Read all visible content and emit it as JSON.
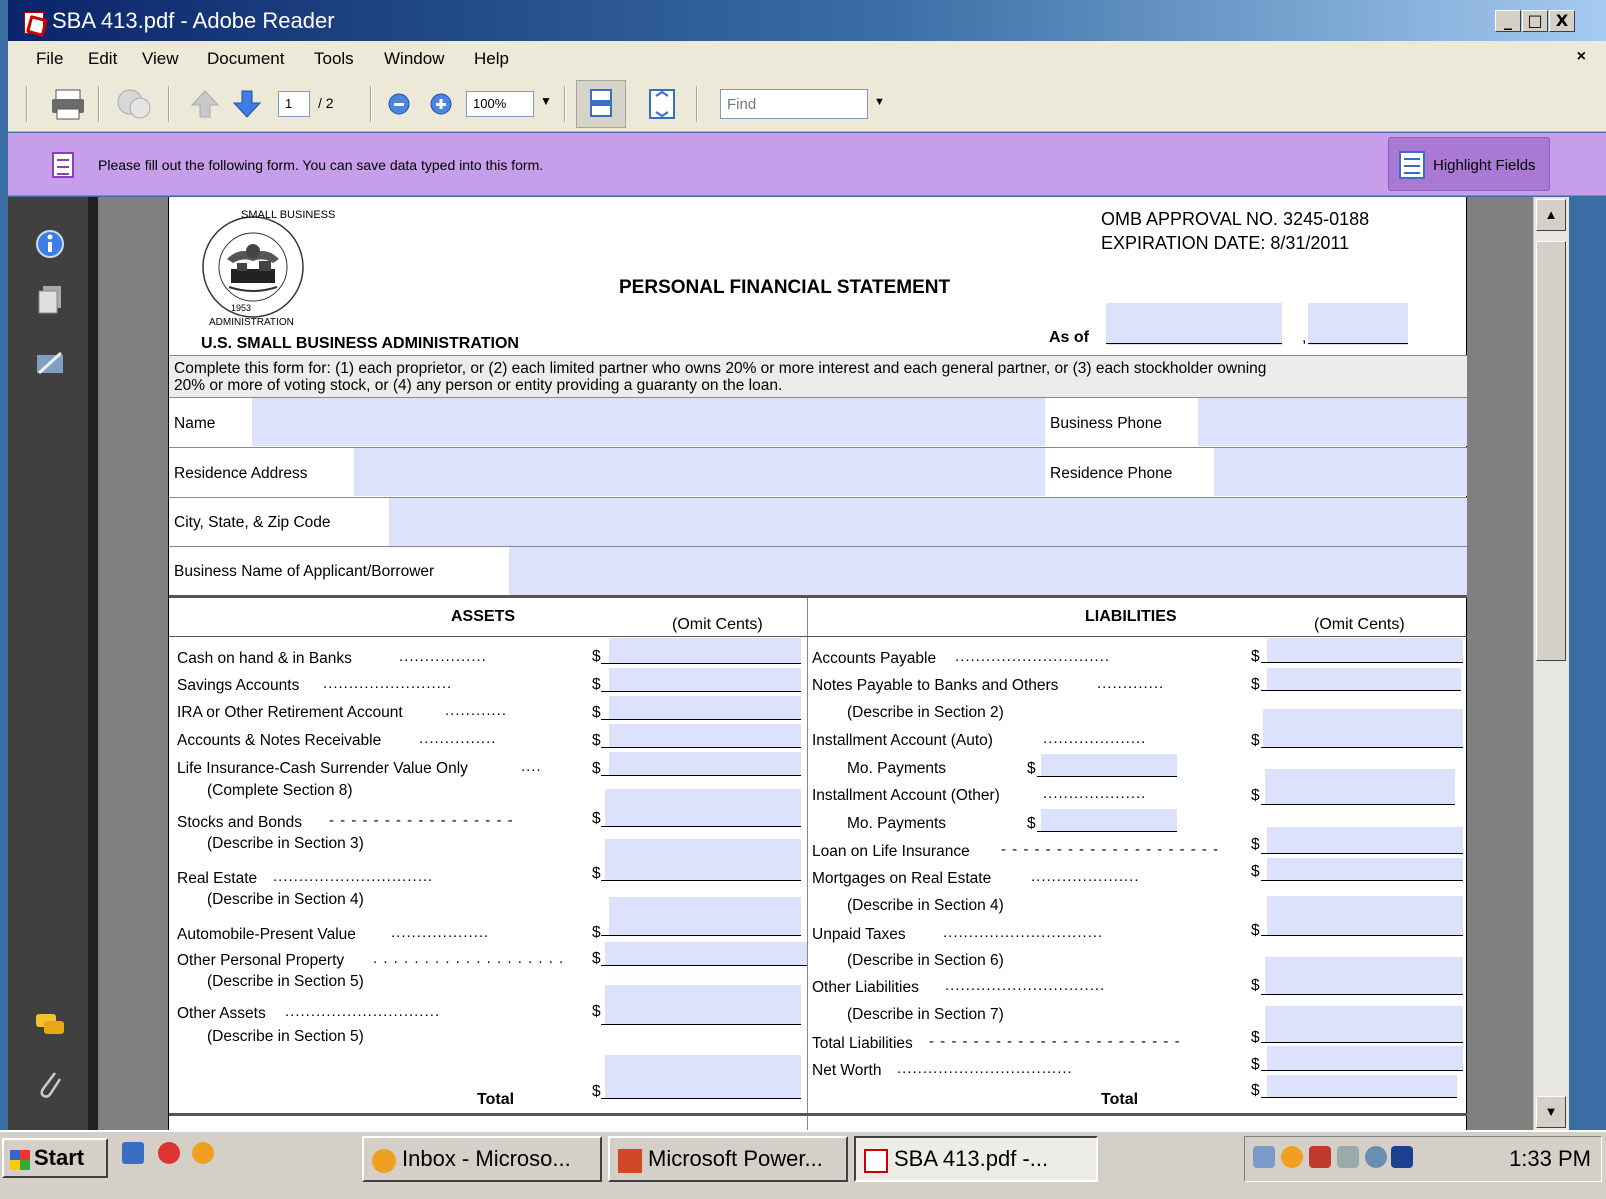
{
  "window": {
    "title": "SBA 413.pdf - Adobe Reader",
    "minimize": "_",
    "maximize": "□",
    "close": "X"
  },
  "menu": {
    "items": [
      "File",
      "Edit",
      "View",
      "Document",
      "Tools",
      "Window",
      "Help"
    ],
    "doc_close": "×"
  },
  "toolbar": {
    "page_current": "1",
    "page_total": "/ 2",
    "zoom": "100%",
    "find_placeholder": "Find"
  },
  "message_bar": {
    "text": "Please fill out the following form. You can save data typed into this form.",
    "highlight_button": "Highlight Fields"
  },
  "form": {
    "seal": {
      "top_text": "SMALL BUSINESS",
      "bottom_text": "ADMINISTRATION",
      "year": "1953"
    },
    "omb_approval": "OMB APPROVAL NO. 3245-0188",
    "expiration": "EXPIRATION DATE: 8/31/2011",
    "title": "PERSONAL FINANCIAL STATEMENT",
    "agency": "U.S. SMALL BUSINESS ADMINISTRATION",
    "as_of_label": "As of",
    "as_of_comma": ",",
    "instructions_line1": "Complete this form for: (1) each proprietor, or (2) each limited partner who owns 20% or more interest and each general partner, or (3) each stockholder owning",
    "instructions_line2": "20% or more of voting stock, or (4) any person or entity providing a guaranty on the loan.",
    "name_label": "Name",
    "business_phone_label": "Business Phone",
    "residence_address_label": "Residence Address",
    "residence_phone_label": "Residence Phone",
    "city_label": "City, State, & Zip Code",
    "business_name_label": "Business Name of Applicant/Borrower",
    "assets_header": "ASSETS",
    "liabilities_header": "LIABILITIES",
    "omit_cents": "(Omit Cents)",
    "dollar": "$",
    "total_label": "Total",
    "assets": {
      "cash": "Cash on hand & in Banks",
      "savings": "Savings Accounts",
      "ira": "IRA or Other Retirement Account",
      "receivable": "Accounts & Notes Receivable",
      "life_insurance": "Life Insurance-Cash Surrender Value Only",
      "complete_section_8": "(Complete Section 8)",
      "stocks": "Stocks and Bonds",
      "describe_section_3": "(Describe in Section 3)",
      "real_estate": "Real Estate",
      "describe_section_4": "(Describe in Section 4)",
      "automobile": "Automobile-Present Value",
      "other_property": "Other Personal Property",
      "describe_section_5a": "(Describe in Section 5)",
      "other_assets": "Other Assets",
      "describe_section_5b": "(Describe in Section 5)"
    },
    "liabilities": {
      "accounts_payable": "Accounts Payable",
      "notes_payable": "Notes Payable to Banks and Others",
      "describe_section_2": "(Describe in Section 2)",
      "installment_auto": "Installment Account (Auto)",
      "mo_payments_1": "Mo. Payments",
      "installment_other": "Installment Account (Other)",
      "mo_payments_2": "Mo. Payments",
      "loan_life": "Loan on Life Insurance",
      "mortgages": "Mortgages on Real Estate",
      "describe_section_4": "(Describe in Section 4)",
      "unpaid_taxes": "Unpaid Taxes",
      "describe_section_6": "(Describe in Section 6)",
      "other_liabilities": "Other Liabilities",
      "describe_section_7": "(Describe in Section 7)",
      "total_liabilities": "Total Liabilities",
      "net_worth": "Net Worth"
    }
  },
  "taskbar": {
    "start": "Start",
    "tasks": [
      "Inbox - Microso...",
      "Microsoft Power...",
      "SBA 413.pdf -..."
    ],
    "clock": "1:33 PM"
  },
  "colors": {
    "field_fill": "#dce2fb",
    "message_bar": "#c79eea",
    "title_bar": "#0a246a"
  }
}
